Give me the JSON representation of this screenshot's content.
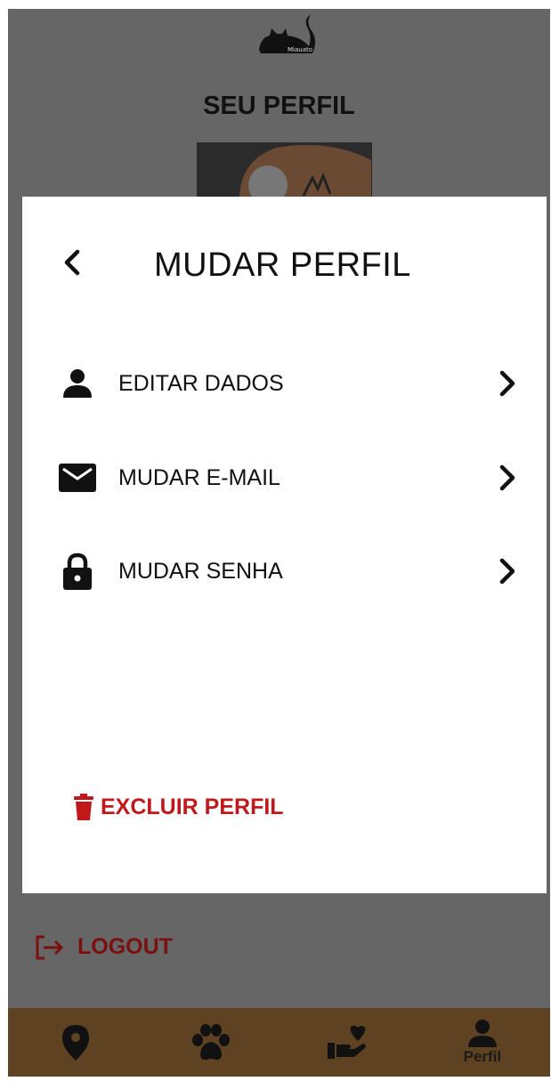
{
  "header": {
    "logo_text": "Miauato",
    "page_title": "SEU PERFIL"
  },
  "modal": {
    "title": "MUDAR PERFIL",
    "items": [
      {
        "label": "EDITAR DADOS",
        "icon": "person-icon"
      },
      {
        "label": "MUDAR E-MAIL",
        "icon": "mail-icon"
      },
      {
        "label": "MUDAR SENHA",
        "icon": "lock-icon"
      }
    ],
    "delete_label": "EXCLUIR PERFIL"
  },
  "logout_label": "LOGOUT",
  "nav": {
    "items": [
      {
        "icon": "location-pin-icon",
        "label": ""
      },
      {
        "icon": "paw-icon",
        "label": ""
      },
      {
        "icon": "heart-hand-icon",
        "label": ""
      },
      {
        "icon": "person-icon",
        "label": "Perfil",
        "active": true
      }
    ]
  },
  "colors": {
    "overlay": "#666666",
    "nav_bg": "#5e4221",
    "danger": "#c0181b",
    "logout": "#7a1010"
  }
}
